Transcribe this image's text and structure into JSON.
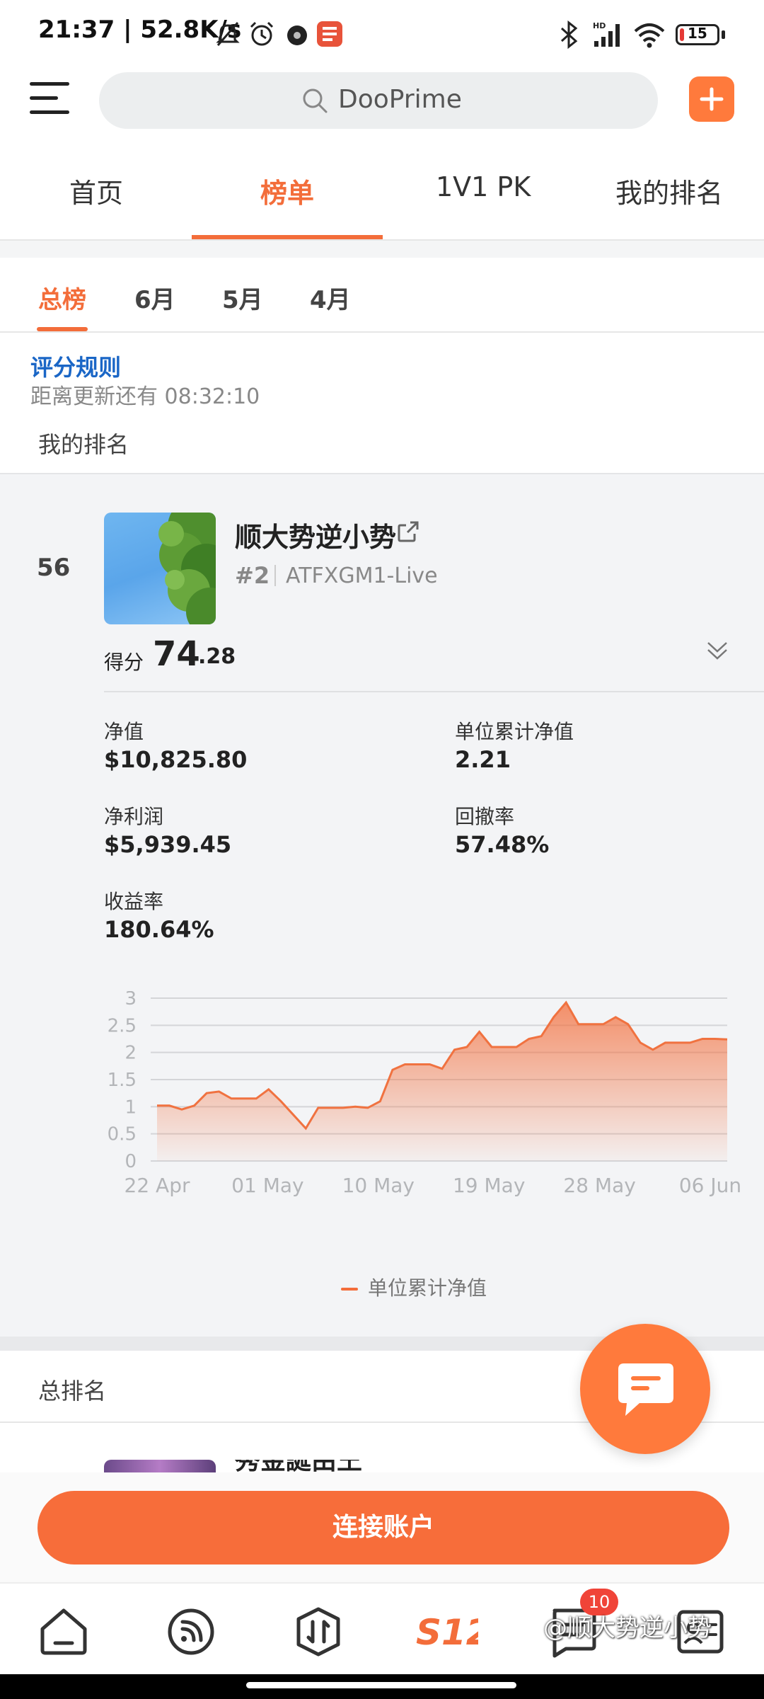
{
  "status_bar": {
    "left_text": "21:37 | 52.8K/s",
    "battery": "15"
  },
  "search": {
    "placeholder": "DooPrime"
  },
  "main_tabs": [
    {
      "label": "首页"
    },
    {
      "label": "榜单",
      "active": true
    },
    {
      "label": "1V1 PK"
    },
    {
      "label": "我的排名"
    }
  ],
  "sub_tabs": [
    {
      "label": "总榜",
      "active": true
    },
    {
      "label": "6月"
    },
    {
      "label": "5月"
    },
    {
      "label": "4月"
    }
  ],
  "rules_link": "评分规则",
  "update_countdown": "距离更新还有 08:32:10",
  "my_rank_section": "我的排名",
  "my_entry": {
    "rank": "56",
    "name": "顺大势逆小势",
    "rank_tag": "#2",
    "account": "ATFXGM1-Live",
    "score_label": "得分",
    "score_int": "74",
    "score_dec": ".28",
    "stats": [
      {
        "label": "净值",
        "value": "$10,825.80"
      },
      {
        "label": "单位累计净值",
        "value": "2.21"
      },
      {
        "label": "净利润",
        "value": "$5,939.45"
      },
      {
        "label": "回撤率",
        "value": "57.48%"
      },
      {
        "label": "收益率",
        "value": "180.64%"
      }
    ]
  },
  "chart_data": {
    "type": "area",
    "series": [
      {
        "name": "单位累计净值",
        "values": [
          1.02,
          1.02,
          0.95,
          1.02,
          1.25,
          1.28,
          1.15,
          1.15,
          1.15,
          1.32,
          1.1,
          0.85,
          0.6,
          0.98,
          0.98,
          0.98,
          1.0,
          0.98,
          1.1,
          1.68,
          1.78,
          1.78,
          1.78,
          1.7,
          2.05,
          2.1,
          2.38,
          2.1,
          2.1,
          2.1,
          2.25,
          2.3,
          2.65,
          2.92,
          2.52,
          2.52,
          2.52,
          2.65,
          2.52,
          2.18,
          2.05,
          2.18,
          2.18,
          2.18,
          2.25,
          2.25,
          2.24
        ]
      }
    ],
    "x_tick_labels": [
      "22 Apr",
      "01 May",
      "10 May",
      "19 May",
      "28 May",
      "06 Jun"
    ],
    "y_tick_labels": [
      "0",
      "0.5",
      "1",
      "1.5",
      "2",
      "2.5",
      "3"
    ],
    "ylim": [
      0,
      3
    ],
    "grid": true,
    "legend_position": "bottom"
  },
  "total_rank_section": "总排名",
  "next_entry_name": "秀金誕由王",
  "connect_button": "连接账户",
  "nav_badge": "10",
  "nav_icons": [
    "home-icon",
    "feed-icon",
    "trade-icon",
    "s12-icon",
    "message-icon",
    "profile-icon"
  ],
  "watermark": "@顺大势逆小势",
  "colors": {
    "accent": "#f36d3a",
    "link": "#1a66c6"
  }
}
